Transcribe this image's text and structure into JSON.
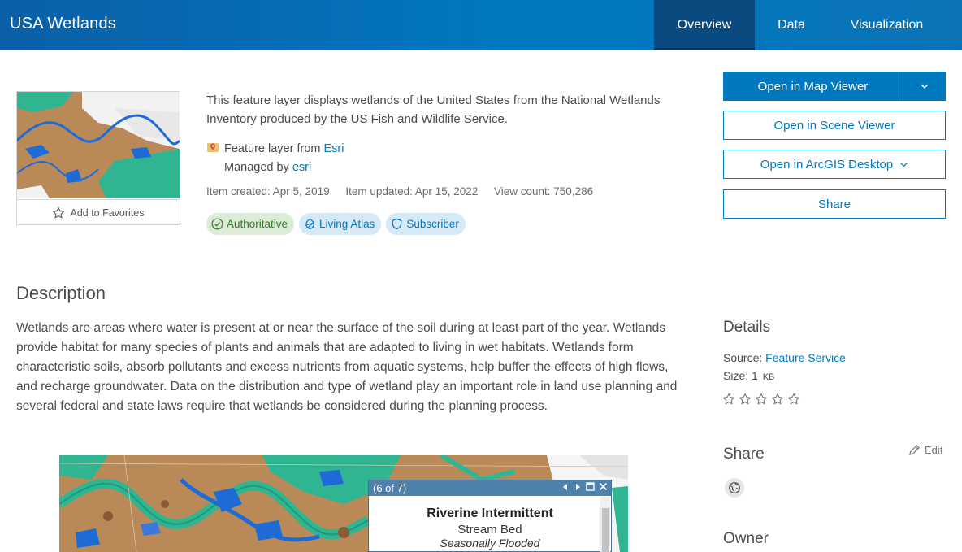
{
  "header": {
    "title": "USA Wetlands",
    "tabs": [
      {
        "label": "Overview",
        "active": true
      },
      {
        "label": "Data",
        "active": false
      },
      {
        "label": "Visualization",
        "active": false
      }
    ]
  },
  "thumbnail": {
    "favorites_label": "Add to Favorites"
  },
  "summary": {
    "text": "This feature layer displays wetlands of the United States from the National Wetlands Inventory produced by the US Fish and Wildlife Service.",
    "layer_type_prefix": "Feature layer from",
    "layer_source": "Esri",
    "managed_prefix": "Managed by",
    "managed_by": "esri",
    "created": "Item created: Apr 5, 2019",
    "updated": "Item updated: Apr 15, 2022",
    "views": "View count: 750,286"
  },
  "badges": [
    {
      "label": "Authoritative",
      "icon": "check-circle-icon"
    },
    {
      "label": "Living Atlas",
      "icon": "living-atlas-icon"
    },
    {
      "label": "Subscriber",
      "icon": "shield-icon"
    }
  ],
  "actions": {
    "map_viewer": "Open in Map Viewer",
    "scene_viewer": "Open in Scene Viewer",
    "desktop": "Open in ArcGIS Desktop",
    "share": "Share"
  },
  "description": {
    "heading": "Description",
    "text": "Wetlands are areas where water is present at or near the surface of the soil during at least part of the year. Wetlands provide habitat for many species of plants and animals that are adapted to living in wet habitats. Wetlands form characteristic soils, absorb pollutants and excess nutrients from aquatic systems, help buffer the effects of high flows, and recharge groundwater. Data on the distribution and type of wetland play an important role in land use planning and several federal and state laws require that wetlands be considered during the planning process."
  },
  "popup": {
    "counter": "(6 of 7)",
    "title": "Riverine Intermittent",
    "line2": "Stream Bed",
    "line3": "Seasonally Flooded"
  },
  "details": {
    "heading": "Details",
    "source_label": "Source:",
    "source_value": "Feature Service",
    "size_label": "Size: 1",
    "size_unit": "KB",
    "rating": 0,
    "rating_max": 5
  },
  "share": {
    "heading": "Share",
    "edit_label": "Edit"
  },
  "owner": {
    "heading": "Owner"
  },
  "colors": {
    "brand": "#0079c1",
    "wetland": "#b98a58",
    "water": "#1e6bd6",
    "green": "#2fb592"
  }
}
